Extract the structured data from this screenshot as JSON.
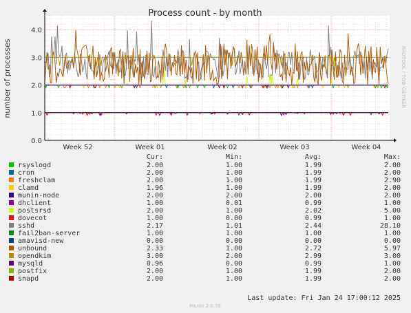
{
  "chart_data": {
    "type": "line",
    "title": "Process count - by month",
    "ylabel": "number of processes",
    "watermark": "RRDTOOL / TOBI OETIKER",
    "ylim": [
      0,
      4.5
    ],
    "yticks": [
      "0.0",
      "1.0",
      "2.0",
      "3.0",
      "4.0"
    ],
    "xticks": [
      "Week 52",
      "Week 01",
      "Week 02",
      "Week 03",
      "Week 04"
    ],
    "legend_headers": {
      "cur": "Cur:",
      "min": "Min:",
      "avg": "Avg:",
      "max": "Max:"
    },
    "series": [
      {
        "name": "rsyslogd",
        "color": "#00cc00",
        "cur": "2.00",
        "min": "1.00",
        "avg": "1.99",
        "max": "2.00"
      },
      {
        "name": "cron",
        "color": "#0066b3",
        "cur": "2.00",
        "min": "1.00",
        "avg": "1.99",
        "max": "2.00"
      },
      {
        "name": "freshclam",
        "color": "#ff8000",
        "cur": "2.00",
        "min": "1.00",
        "avg": "1.99",
        "max": "2.90"
      },
      {
        "name": "clamd",
        "color": "#ffcc00",
        "cur": "1.96",
        "min": "1.00",
        "avg": "1.99",
        "max": "2.00"
      },
      {
        "name": "munin-node",
        "color": "#330099",
        "cur": "2.00",
        "min": "2.00",
        "avg": "2.00",
        "max": "2.00"
      },
      {
        "name": "dhclient",
        "color": "#990099",
        "cur": "1.00",
        "min": "0.01",
        "avg": "0.99",
        "max": "1.00"
      },
      {
        "name": "postsrsd",
        "color": "#ccff00",
        "cur": "2.00",
        "min": "1.00",
        "avg": "2.02",
        "max": "5.00"
      },
      {
        "name": "dovecot",
        "color": "#ff0000",
        "cur": "1.00",
        "min": "0.00",
        "avg": "0.99",
        "max": "1.00"
      },
      {
        "name": "sshd",
        "color": "#808080",
        "cur": "2.17",
        "min": "1.01",
        "avg": "2.44",
        "max": "28.10"
      },
      {
        "name": "fail2ban-server",
        "color": "#008f00",
        "cur": "1.00",
        "min": "1.00",
        "avg": "1.00",
        "max": "1.00"
      },
      {
        "name": "amavisd-new",
        "color": "#00487d",
        "cur": "0.00",
        "min": "0.00",
        "avg": "0.00",
        "max": "0.00"
      },
      {
        "name": "unbound",
        "color": "#b35a00",
        "cur": "2.33",
        "min": "1.00",
        "avg": "2.72",
        "max": "5.97"
      },
      {
        "name": "opendkim",
        "color": "#b38f00",
        "cur": "3.00",
        "min": "2.00",
        "avg": "2.99",
        "max": "3.00"
      },
      {
        "name": "mysqld",
        "color": "#6b006b",
        "cur": "0.96",
        "min": "0.00",
        "avg": "0.99",
        "max": "1.00"
      },
      {
        "name": "postfix",
        "color": "#8fb300",
        "cur": "2.00",
        "min": "1.00",
        "avg": "1.99",
        "max": "2.00"
      },
      {
        "name": "snapd",
        "color": "#b30000",
        "cur": "2.00",
        "min": "1.00",
        "avg": "1.99",
        "max": "2.00"
      }
    ],
    "last_update": "Last update: Fri Jan 24 17:00:12 2025",
    "footer": "Munin 2.0.76"
  }
}
